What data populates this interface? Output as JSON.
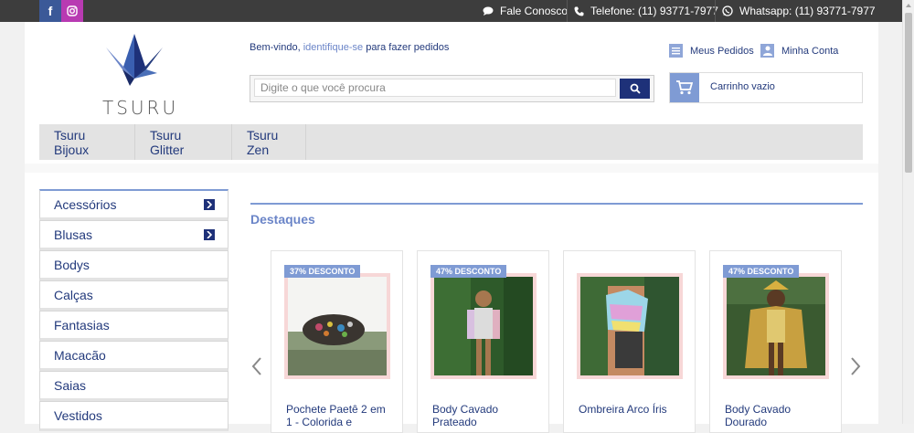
{
  "topbar": {
    "facebook_icon": "facebook-icon",
    "instagram_icon": "instagram-icon",
    "contact": "Fale Conosco",
    "phone": "Telefone: (11) 93771-7977",
    "whatsapp": "Whatsapp: (11) 93771-7977"
  },
  "brand": {
    "logo_text": "TSURU"
  },
  "header": {
    "welcome_prefix": "Bem-vindo,",
    "welcome_link": "identifique-se",
    "welcome_suffix": "para fazer pedidos",
    "search_placeholder": "Digite o que você procura",
    "orders": "Meus Pedidos",
    "account": "Minha Conta",
    "cart": "Carrinho vazio"
  },
  "nav": [
    "Tsuru Bijoux",
    "Tsuru Glitter",
    "Tsuru Zen"
  ],
  "sidebar": [
    {
      "label": "Acessórios",
      "has_arrow": true
    },
    {
      "label": "Blusas",
      "has_arrow": true
    },
    {
      "label": "Bodys",
      "has_arrow": false
    },
    {
      "label": "Calças",
      "has_arrow": false
    },
    {
      "label": "Fantasias",
      "has_arrow": false
    },
    {
      "label": "Macacão",
      "has_arrow": false
    },
    {
      "label": "Saias",
      "has_arrow": false
    },
    {
      "label": "Vestidos",
      "has_arrow": false
    }
  ],
  "section_title": "Destaques",
  "products": [
    {
      "name": "Pochete Paetê 2 em 1 - Colorida e",
      "discount": "37% DESCONTO"
    },
    {
      "name": "Body Cavado Prateado",
      "discount": "47% DESCONTO"
    },
    {
      "name": "Ombreira Arco Íris",
      "discount": ""
    },
    {
      "name": "Body Cavado Dourado",
      "discount": "47% DESCONTO"
    }
  ],
  "colors": {
    "brand_navy": "#1e3179",
    "accent_blue": "#7f9bd4",
    "topbar": "#3d3d3d"
  }
}
